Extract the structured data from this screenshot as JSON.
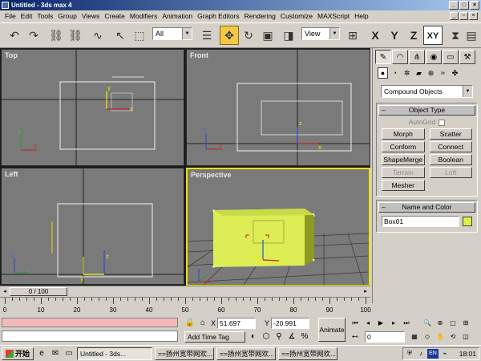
{
  "window": {
    "title": "Untitled - 3ds max 4"
  },
  "menu": [
    "File",
    "Edit",
    "Tools",
    "Group",
    "Views",
    "Create",
    "Modifiers",
    "Animation",
    "Graph Editors",
    "Rendering",
    "Customize",
    "MAXScript",
    "Help"
  ],
  "toolbar": {
    "selection_filter": "All",
    "reference_coord": "View",
    "axis_buttons": [
      "X",
      "Y",
      "Z",
      "XY"
    ]
  },
  "viewports": {
    "top": "Top",
    "front": "Front",
    "left": "Left",
    "perspective": "Perspective"
  },
  "command_panel": {
    "category": "Compound Objects",
    "object_type_title": "Object Type",
    "autogrid": "AutoGrid",
    "buttons": [
      {
        "label": "Morph",
        "enabled": true
      },
      {
        "label": "Scatter",
        "enabled": true
      },
      {
        "label": "Conform",
        "enabled": true
      },
      {
        "label": "Connect",
        "enabled": true
      },
      {
        "label": "ShapeMerge",
        "enabled": true
      },
      {
        "label": "Boolean",
        "enabled": true
      },
      {
        "label": "Terrain",
        "enabled": false
      },
      {
        "label": "Loft",
        "enabled": false
      },
      {
        "label": "Mesher",
        "enabled": true
      }
    ],
    "name_color_title": "Name and Color",
    "object_name": "Box01",
    "object_color": "#d9f24a"
  },
  "timeline": {
    "slider_label": "0 / 100",
    "tick_labels": [
      "0",
      "10",
      "20",
      "30",
      "40",
      "50",
      "60",
      "70",
      "80",
      "90",
      "100"
    ]
  },
  "status": {
    "x_label": "X",
    "x_value": "51.697",
    "y_label": "Y",
    "y_value": "-20.991",
    "add_time_tag": "Add Time Tag",
    "animate": "Animate",
    "current_frame": "0"
  },
  "taskbar": {
    "start": "开始",
    "tasks": [
      "Untitled - 3ds...",
      "==扬州宽带网欢...",
      "==扬州宽带网欢...",
      "==扬州宽带网欢..."
    ],
    "lang": "EN",
    "clock": "18:01"
  }
}
